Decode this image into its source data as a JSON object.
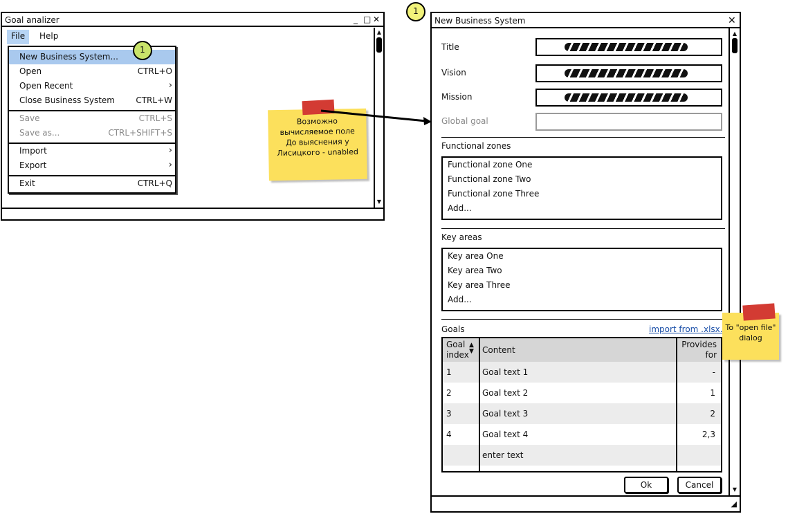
{
  "main_window": {
    "title": "Goal analizer",
    "controls": {
      "minimize": "_",
      "maximize": "□",
      "close": "✕"
    },
    "menu": {
      "file": "File",
      "help": "Help"
    },
    "file_menu": [
      {
        "label": "New Business System...",
        "shortcut": ""
      },
      {
        "label": "Open",
        "shortcut": "CTRL+O"
      },
      {
        "label": "Open Recent",
        "submenu": true
      },
      {
        "label": "Close Business System",
        "shortcut": "CTRL+W"
      },
      {
        "label": "Save",
        "shortcut": "CTRL+S",
        "disabled": true
      },
      {
        "label": "Save as...",
        "shortcut": "CTRL+SHIFT+S",
        "disabled": true
      },
      {
        "label": "Import",
        "submenu": true
      },
      {
        "label": "Export",
        "submenu": true
      },
      {
        "label": "Exit",
        "shortcut": "CTRL+Q"
      }
    ]
  },
  "badges": {
    "menu_marker": "1",
    "dialog_marker": "1"
  },
  "notes": {
    "global_goal_note": [
      "Возможно",
      "вычисляемое поле",
      "До выяснения у",
      "Лисицкого - unabled"
    ],
    "import_note": [
      "To \"open file\"",
      "dialog"
    ]
  },
  "dialog": {
    "title": "New Business System",
    "close": "✕",
    "fields": {
      "title_label": "Title",
      "vision_label": "Vision",
      "mission_label": "Mission",
      "global_goal_label": "Global goal"
    },
    "functional_zones": {
      "heading": "Functional zones",
      "items": [
        "Functional zone One",
        "Functional zone Two",
        "Functional zone Three",
        "Add..."
      ]
    },
    "key_areas": {
      "heading": "Key areas",
      "items": [
        "Key area One",
        "Key area Two",
        "Key area Three",
        "Add..."
      ]
    },
    "goals": {
      "heading": "Goals",
      "import_link": "import from .xlsx...",
      "columns": {
        "index_1": "Goal",
        "index_2": "index",
        "content": "Content",
        "provides_1": "Provides",
        "provides_2": "for"
      },
      "rows": [
        {
          "index": "1",
          "content": "Goal text 1",
          "provides": "-"
        },
        {
          "index": "2",
          "content": "Goal text 2",
          "provides": "1"
        },
        {
          "index": "3",
          "content": "Goal text 3",
          "provides": "2"
        },
        {
          "index": "4",
          "content": "Goal text 4",
          "provides": "2,3"
        },
        {
          "index": "",
          "content": "enter text",
          "provides": ""
        }
      ]
    },
    "buttons": {
      "ok": "Ok",
      "cancel": "Cancel"
    }
  }
}
